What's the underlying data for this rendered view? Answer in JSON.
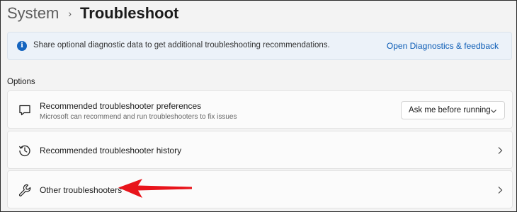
{
  "breadcrumb": {
    "parent": "System",
    "separator": "›",
    "current": "Troubleshoot"
  },
  "info_banner": {
    "icon": "info-icon",
    "text": "Share optional diagnostic data to get additional troubleshooting recommendations.",
    "link": "Open Diagnostics & feedback"
  },
  "section": {
    "label": "Options"
  },
  "items": [
    {
      "icon": "chat-bubble-icon",
      "title": "Recommended troubleshooter preferences",
      "subtitle": "Microsoft can recommend and run troubleshooters to fix issues",
      "control": "dropdown",
      "dropdown_value": "Ask me before running"
    },
    {
      "icon": "history-icon",
      "title": "Recommended troubleshooter history",
      "control": "chevron"
    },
    {
      "icon": "wrench-icon",
      "title": "Other troubleshooters",
      "control": "chevron"
    }
  ],
  "colors": {
    "accent": "#0a5bb5",
    "banner_bg": "#ecf2f9",
    "annotation_arrow": "#e8141b"
  }
}
